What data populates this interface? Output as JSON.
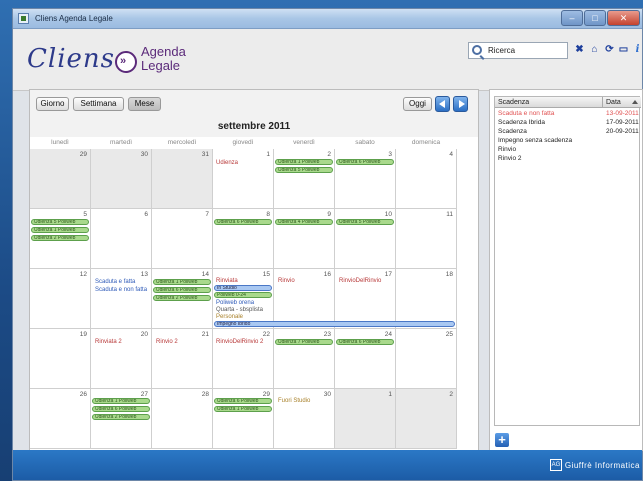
{
  "window": {
    "title": "Cliens Agenda Legale"
  },
  "logo": {
    "brand": "Cliens",
    "line1": "Agenda",
    "line2": "Legale"
  },
  "search": {
    "value": "Ricerca"
  },
  "toolbar": {
    "info_label": "i"
  },
  "calendar": {
    "views": {
      "day": "Giorno",
      "week": "Settimana",
      "month": "Mese"
    },
    "today_label": "Oggi",
    "month_title": "settembre 2011",
    "weekdays": [
      "lunedì",
      "martedì",
      "mercoledì",
      "giovedì",
      "venerdì",
      "sabato",
      "domenica"
    ],
    "days": [
      "29",
      "30",
      "31",
      "1",
      "2",
      "3",
      "4",
      "5",
      "6",
      "7",
      "8",
      "9",
      "10",
      "11",
      "12",
      "13",
      "14",
      "15",
      "16",
      "17",
      "18",
      "19",
      "20",
      "21",
      "22",
      "23",
      "24",
      "25",
      "26",
      "27",
      "28",
      "29",
      "30",
      "1",
      "2"
    ],
    "events": {
      "udienza": "Udienza",
      "udienza_1_poliweb": "Udienza 1 Poliweb",
      "udienza_2_poliweb": "Udienza 2 Poliweb",
      "udienza_3_poliweb": "Udienza 3 Poliweb",
      "udienza_4_poliweb": "Udienza 4 Poliweb",
      "udienza_5_poliweb": "Udienza 5 Poliweb",
      "udienza_6_poliweb": "Udienza 6 Poliweb",
      "udienza_7_poliweb": "Udienza 7 Poliweb",
      "scaduta_e_fatta": "Scaduta e fatta",
      "scaduta_e_non_fatta": "Scaduta e non fatta",
      "rinviata": "Rinviata",
      "rinvio": "Rinvio",
      "rinvio_del_rinvio": "RinvioDelRinvio",
      "rinviata_2": "Rinviata 2",
      "rinvio_2": "Rinvio 2",
      "rinvio_del_rinvio_2": "RinvioDelRinvio 2",
      "in_studio": "In Studio",
      "poliweb_024": "Poliweb 0-24",
      "poliweb_orena": "Poliweb orena",
      "quarta_sbsplista": "Quarta - sbsplista",
      "personale": "Personale",
      "impegno_ibrido": "Impegno Ibrido",
      "fuori_studio": "Fuori Studio"
    }
  },
  "deadlines": {
    "col_deadline": "Scadenza",
    "col_date": "Data",
    "rows": [
      {
        "name": "Scaduta e non fatta",
        "date": "13-09-2011"
      },
      {
        "name": "Scadenza Ibrida",
        "date": "17-09-2011"
      },
      {
        "name": "Scadenza",
        "date": "20-09-2011"
      },
      {
        "name": "Impegno senza scadenza",
        "date": ""
      },
      {
        "name": "Rinvio",
        "date": ""
      },
      {
        "name": "Rinvio 2",
        "date": ""
      }
    ]
  },
  "footer": {
    "brand": "Giuffrè Informatica",
    "logo": "AG"
  },
  "colors": {
    "accent_red": "#e05050",
    "event_green": "#a9d98c",
    "event_blue": "#a9c8f2",
    "footer_blue": "#1c5ca6"
  }
}
